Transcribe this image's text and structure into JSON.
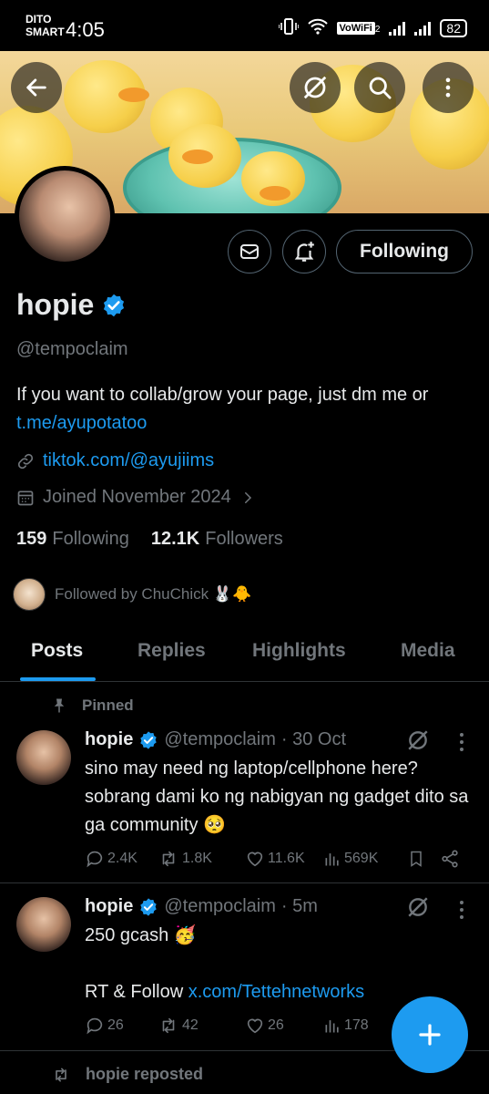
{
  "status_bar": {
    "carrier_line1": "DITO",
    "carrier_line2": "SMART",
    "time": "4:05",
    "vowifi": "VoWiFi",
    "vowifi_sub": "2",
    "battery": "82"
  },
  "profile": {
    "name": "hopie",
    "handle": "@tempoclaim",
    "bio_text": "If you want to collab/grow your page, just dm me or ",
    "bio_link": "t.me/ayupotatoo",
    "website": "tiktok.com/@ayujiims",
    "joined": "Joined November 2024",
    "following_count": "159",
    "following_label": "Following",
    "followers_count": "12.1K",
    "followers_label": "Followers",
    "followed_by": "Followed by ChuChick 🐰🐥",
    "following_button": "Following"
  },
  "tabs": [
    "Posts",
    "Replies",
    "Highlights",
    "Media"
  ],
  "posts": [
    {
      "pinned_label": "Pinned",
      "name": "hopie",
      "handle": "@tempoclaim",
      "time": "· 30 Oct",
      "text": "sino may need ng laptop/cellphone here? sobrang dami ko ng nabigyan ng gadget dito sa ga community 🥺",
      "replies": "2.4K",
      "reposts": "1.8K",
      "likes": "11.6K",
      "views": "569K"
    },
    {
      "name": "hopie",
      "handle": "@tempoclaim",
      "time": "· 5m",
      "text_line1": "250 gcash 🥳",
      "text_line2_prefix": "RT & Follow ",
      "text_line2_link": "x.com/Tettehnetworks",
      "replies": "26",
      "reposts": "42",
      "likes": "26",
      "views": "178"
    }
  ],
  "repost_notice": "hopie reposted",
  "colors": {
    "accent": "#1d9bf0",
    "text": "#e7e9ea",
    "muted": "#71767b",
    "border": "#2f3336",
    "background": "#000000"
  }
}
